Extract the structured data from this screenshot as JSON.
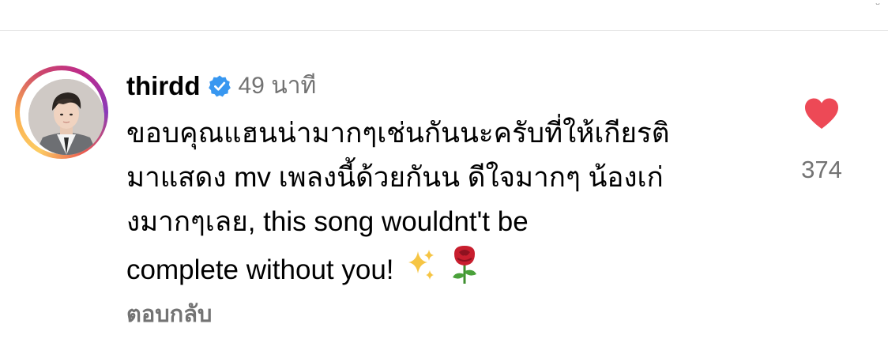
{
  "comment": {
    "username": "thirdd",
    "verified": true,
    "timestamp": "49 นาที",
    "text_lines": [
      "ขอบคุณแฮนน่ามากๆเช่นกันนะครับที่ให้เกียรติ",
      "มาแสดง mv เพลงนี้ด้วยกันน ดีใจมากๆ น้องเก่",
      "งมากๆเลย, this song wouldnt't be",
      "complete without you!"
    ],
    "trailing_emojis": [
      "sparkles-emoji",
      "rose-emoji"
    ],
    "reply_label": "ตอบกลับ",
    "like_count": "374",
    "liked": true
  },
  "icons": {
    "verified": "verified-badge-icon",
    "heart": "heart-icon"
  },
  "colors": {
    "verified_blue": "#3897f0",
    "heart_red": "#ed4956",
    "secondary_text": "#737373",
    "divider": "#e6e6e6"
  }
}
